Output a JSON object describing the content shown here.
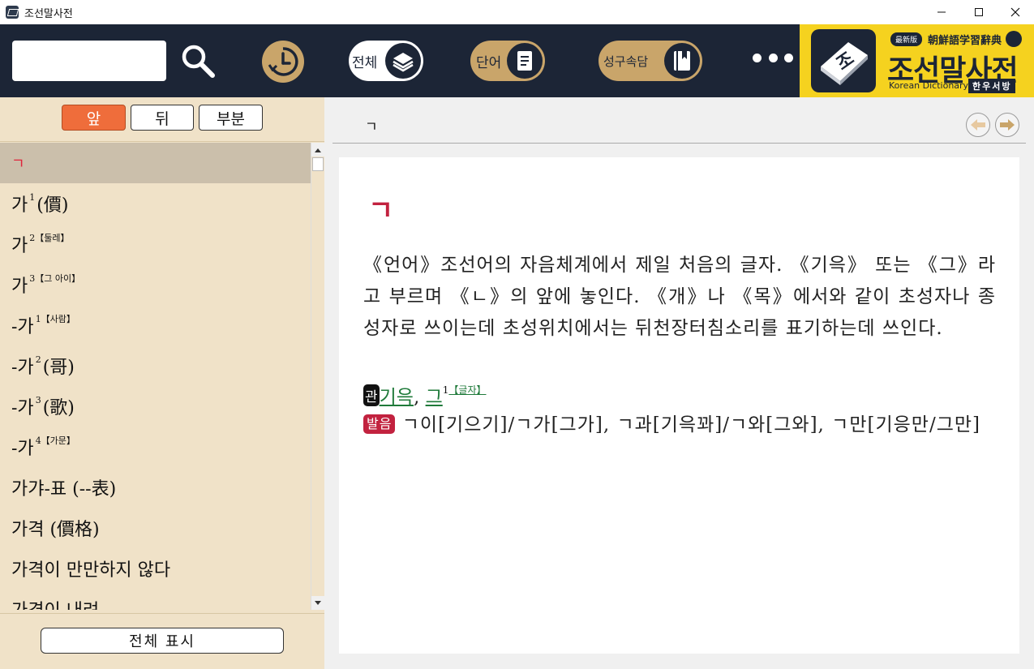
{
  "window": {
    "title": "조선말사전"
  },
  "toolbar": {
    "search_placeholder": "",
    "search_value": "",
    "pill_all_label": "전체",
    "pill_word_label": "단어",
    "pill_idiom_label": "성구속담"
  },
  "logo": {
    "badge": "最新版",
    "cjk_title": "朝鮮語学習辭典",
    "main": "조선말사전",
    "sub": "Korean Dictionary",
    "publisher": "한우서방"
  },
  "left": {
    "seg_front": "앞",
    "seg_back": "뒤",
    "seg_part": "부분",
    "show_all": "전체 표시",
    "items": [
      {
        "word": "ㄱ",
        "sup": "",
        "tail": ""
      },
      {
        "word": "가",
        "sup": "1",
        "tail": "(價)"
      },
      {
        "word": "가",
        "sup": "2【둘레】",
        "tail": ""
      },
      {
        "word": "가",
        "sup": "3【그 아이】",
        "tail": ""
      },
      {
        "word": "-가",
        "sup": "1【사람】",
        "tail": ""
      },
      {
        "word": "-가",
        "sup": "2",
        "tail": "(哥)"
      },
      {
        "word": "-가",
        "sup": "3",
        "tail": "(歌)"
      },
      {
        "word": "-가",
        "sup": "4【가문】",
        "tail": ""
      },
      {
        "word": "가갸-표 (--表)",
        "sup": "",
        "tail": ""
      },
      {
        "word": "가격 (價格)",
        "sup": "",
        "tail": ""
      },
      {
        "word": "가격이 만만하지 않다",
        "sup": "",
        "tail": ""
      },
      {
        "word": "가격이 내려",
        "sup": "",
        "tail": ""
      }
    ]
  },
  "entry": {
    "header_word": "ㄱ",
    "headword": "ㄱ",
    "definition": "《언어》조선어의 자음체계에서 제일 처음의 글자. 《기윽》 또는 《그》라고 부르며 《ㄴ》의 앞에 놓인다. 《개》나 《목》에서와 같이 초성자나 종성자로 쓰이는데 초성위치에서는 뒤천장터침소리를 표기하는데 쓰인다.",
    "rel_tag": "관",
    "rel_word1": "기윽",
    "rel_sep": ", ",
    "rel_word2": "그",
    "rel_word2_sup": "1",
    "rel_word2_note": "【글자】",
    "pron_tag": "발음",
    "pronunciation": "ㄱ이[기으기]/ㄱ가[그가], ㄱ과[기윽꽈]/ㄱ와[그와], ㄱ만[기응만/그만]"
  },
  "colors": {
    "toolbar_bg": "#1c2536",
    "gold": "#c9a56a",
    "logo_yellow": "#f5d21f",
    "left_bg": "#f0e2c8",
    "accent_orange": "#ef6d3b",
    "headword_red": "#c2223f",
    "link_green": "#1f7a3a"
  }
}
